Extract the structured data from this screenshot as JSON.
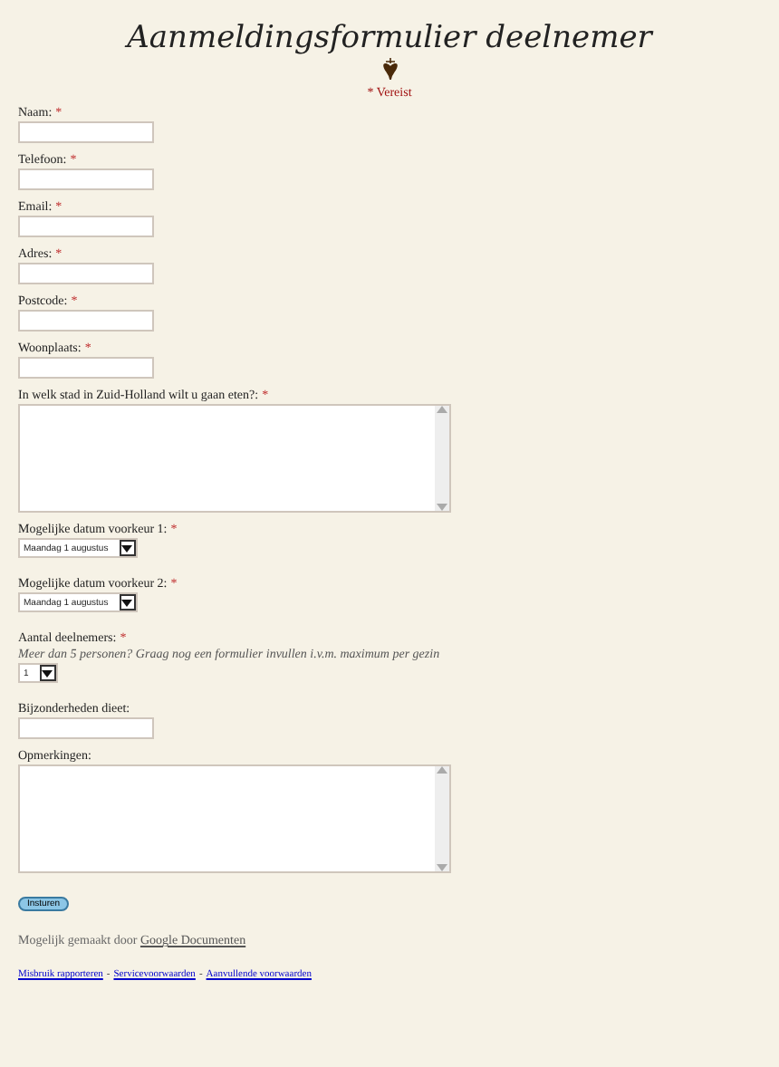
{
  "title": "Aanmeldingsformulier deelnemer",
  "required_note": "* Vereist",
  "required_mark": "*",
  "fields": [
    {
      "kind": "text",
      "label": "Naam:",
      "required": true
    },
    {
      "kind": "text",
      "label": "Telefoon:",
      "required": true
    },
    {
      "kind": "text",
      "label": "Email:",
      "required": true
    },
    {
      "kind": "text",
      "label": "Adres:",
      "required": true
    },
    {
      "kind": "text",
      "label": "Postcode:",
      "required": true
    },
    {
      "kind": "text",
      "label": "Woonplaats:",
      "required": true
    },
    {
      "kind": "textarea",
      "label": "In welk stad in Zuid-Holland wilt u gaan eten?:",
      "required": true
    },
    {
      "kind": "select",
      "label": "Mogelijke datum voorkeur 1:",
      "required": true,
      "value": "Maandag 1 augustus"
    },
    {
      "kind": "select",
      "label": "Mogelijke datum voorkeur 2:",
      "required": true,
      "value": "Maandag 1 augustus"
    },
    {
      "kind": "select",
      "label": "Aantal deelnemers:",
      "required": true,
      "help": "Meer dan 5 personen? Graag nog een formulier invullen i.v.m. maximum per gezin",
      "value": "1"
    },
    {
      "kind": "text",
      "label": "Bijzonderheden dieet:",
      "required": false
    },
    {
      "kind": "textarea",
      "label": "Opmerkingen:",
      "required": false
    }
  ],
  "submit": "Insturen",
  "powered_by": {
    "text": "Mogelijk gemaakt door",
    "link": "Google Documenten"
  },
  "footer_links": [
    "Misbruik rapporteren",
    "Servicevoorwaarden",
    "Aanvullende voorwaarden"
  ],
  "footer_separator": "-"
}
